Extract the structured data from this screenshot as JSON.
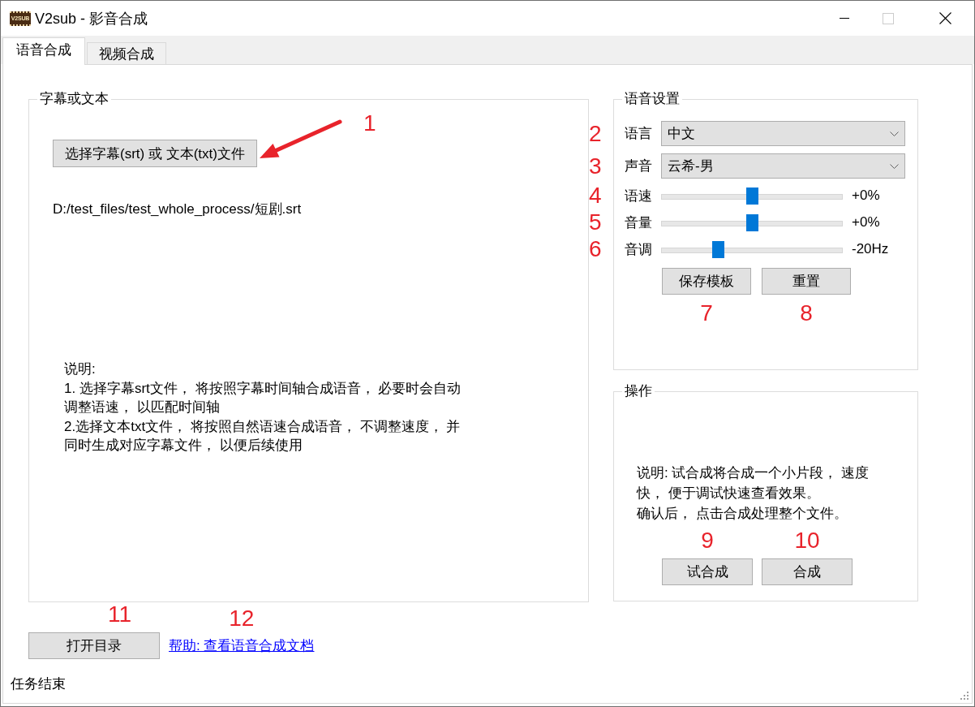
{
  "window": {
    "logo_text": "V2SUB",
    "title": "V2sub - 影音合成",
    "maximize_disabled": true
  },
  "tabs": [
    {
      "label": "语音合成",
      "selected": true
    },
    {
      "label": "视频合成",
      "selected": false
    }
  ],
  "subtitle_group": {
    "title": "字幕或文本",
    "choose_button": {
      "label": "选择字幕(srt) 或 文本(txt)文件",
      "callout": "1",
      "callout_arrow": true
    },
    "file_path": "D:/test_files/test_whole_process/短剧.srt",
    "instructions": [
      "说明:",
      "1. 选择字幕srt文件， 将按照字幕时间轴合成语音， 必要时会自动",
      "调整语速， 以匹配时间轴",
      "2.选择文本txt文件， 将按照自然语速合成语音， 不调整速度， 并",
      "同时生成对应字幕文件， 以便后续使用"
    ]
  },
  "voice_settings": {
    "title": "语音设置",
    "fields": [
      {
        "kind": "dropdown",
        "label": "语言",
        "value": "中文",
        "callout": "2"
      },
      {
        "kind": "dropdown",
        "label": "声音",
        "value": "云希-男",
        "callout": "3"
      },
      {
        "kind": "slider",
        "label": "语速",
        "level": 0.5,
        "reading": "+0%",
        "callout": "4"
      },
      {
        "kind": "slider",
        "label": "音量",
        "level": 0.5,
        "reading": "+0%",
        "callout": "5"
      },
      {
        "kind": "slider",
        "label": "音调",
        "level": 0.3,
        "reading": "-20Hz",
        "callout": "6"
      }
    ],
    "buttons": [
      {
        "label": "保存模板",
        "callout": "7"
      },
      {
        "label": "重置",
        "callout": "8"
      }
    ]
  },
  "operations": {
    "title": "操作",
    "note": [
      "说明: 试合成将合成一个小片段， 速度",
      "快， 便于调试快速查看效果。",
      "确认后， 点击合成处理整个文件。"
    ],
    "buttons": [
      {
        "label": "试合成",
        "callout": "9"
      },
      {
        "label": "合成",
        "callout": "10"
      }
    ]
  },
  "footer": {
    "open_folder_button": {
      "label": "打开目录",
      "callout": "11"
    },
    "help_link": {
      "label": "帮助: 查看语音合成文档",
      "callout": "12"
    }
  },
  "status_bar": {
    "text": "任务结束"
  }
}
